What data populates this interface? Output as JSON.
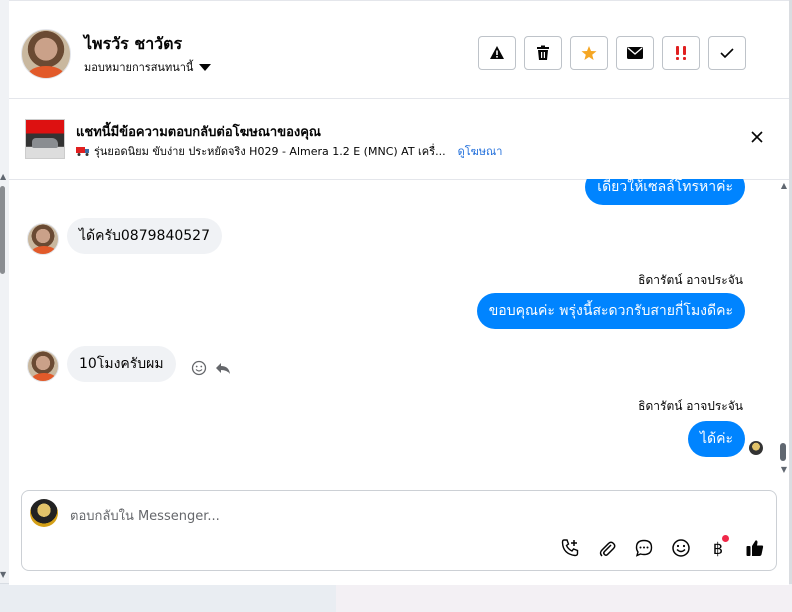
{
  "header": {
    "contact_name": "ไพรวัร ชาวัตร",
    "assign_label": "มอบหมายการสนทนานี้",
    "actions": [
      {
        "name": "report-spam",
        "icon": "warning-icon"
      },
      {
        "name": "delete",
        "icon": "trash-icon"
      },
      {
        "name": "star",
        "icon": "star-icon"
      },
      {
        "name": "mark-unread",
        "icon": "envelope-icon"
      },
      {
        "name": "mark-important",
        "icon": "double-exclamation-icon"
      },
      {
        "name": "mark-done",
        "icon": "check-icon"
      }
    ]
  },
  "ad_banner": {
    "title": "แชทนี้มีข้อความตอบกลับต่อโฆษณาของคุณ",
    "description": "รุ่นยอดนิยม ขับง่าย ประหยัดจริง H029 - Almera 1.2 E (MNC) AT เครื่...",
    "link_label": "ดูโฆษณา"
  },
  "messages": [
    {
      "direction": "out",
      "text": "เดี๋ยวให้เซลล์โทรหาค่ะ",
      "sender": ""
    },
    {
      "direction": "in",
      "text": "ได้ครับ0879840527",
      "sender": ""
    },
    {
      "direction": "out",
      "text": "ขอบคุณค่ะ พรุ่งนี้สะดวกรับสายกี่โมงดีคะ",
      "sender": "ธิดารัตน์ อาจประจัน"
    },
    {
      "direction": "in",
      "text": "10โมงครับผม",
      "sender": ""
    },
    {
      "direction": "out",
      "text": "ได้ค่ะ",
      "sender": "ธิดารัตน์ อาจประจัน"
    }
  ],
  "composer": {
    "placeholder": "ตอบกลับใน Messenger...",
    "tools": [
      "call-add-icon",
      "paperclip-icon",
      "chat-bubble-icon",
      "emoji-icon",
      "baht-icon",
      "thumbs-up-icon"
    ],
    "baht_symbol": "฿",
    "notification_color": "#f02849"
  },
  "colors": {
    "accent": "#0084ff",
    "star": "#f5a623",
    "important": "#e02020"
  }
}
